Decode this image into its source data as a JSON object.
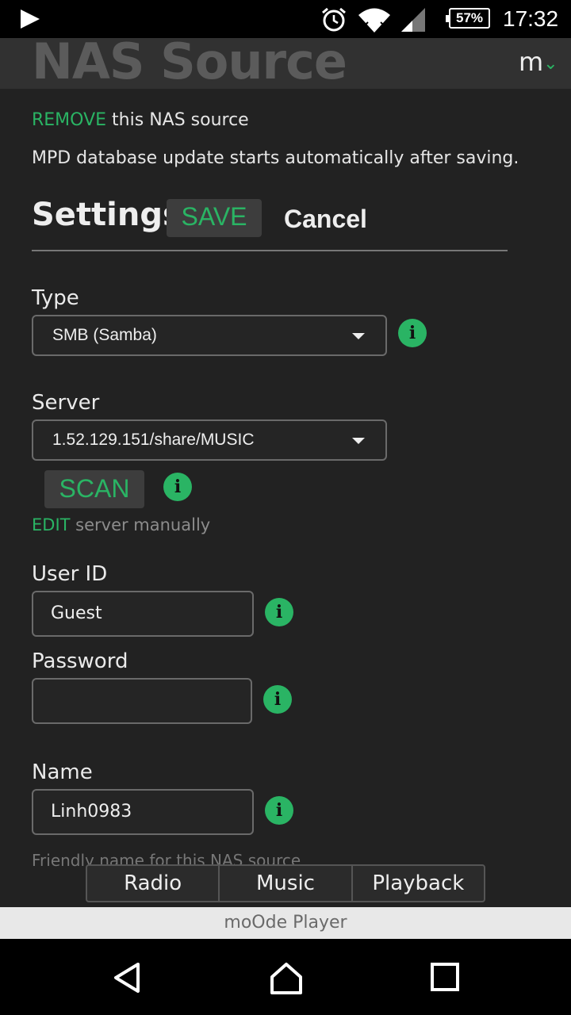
{
  "status_bar": {
    "battery": "57%",
    "time": "17:32",
    "icons": [
      "play-store-icon",
      "alarm-icon",
      "wifi-icon",
      "signal-icon",
      "battery-icon"
    ]
  },
  "header": {
    "title": "NAS Source",
    "menu_label": "m",
    "menu_chevron": "✓"
  },
  "remove_line": {
    "link": "REMOVE",
    "rest": " this NAS source"
  },
  "notice": "MPD database update starts automatically after saving.",
  "settings": {
    "title": "Settings",
    "save": "SAVE",
    "cancel": "Cancel"
  },
  "type": {
    "label": "Type",
    "value": "SMB (Samba)"
  },
  "server": {
    "label": "Server",
    "value": "1.52.129.151/share/MUSIC",
    "scan": "SCAN",
    "edit_link": "EDIT",
    "edit_rest": " server manually"
  },
  "user_id": {
    "label": "User ID",
    "value": "Guest"
  },
  "password": {
    "label": "Password",
    "value": ""
  },
  "name": {
    "label": "Name",
    "value": "Linh0983",
    "help": "Friendly name for this NAS source"
  },
  "tabs": [
    "Radio",
    "Music",
    "Playback"
  ],
  "footer": "moOde Player",
  "colors": {
    "accent": "#2ab464",
    "background": "#222222",
    "header": "#313131"
  }
}
